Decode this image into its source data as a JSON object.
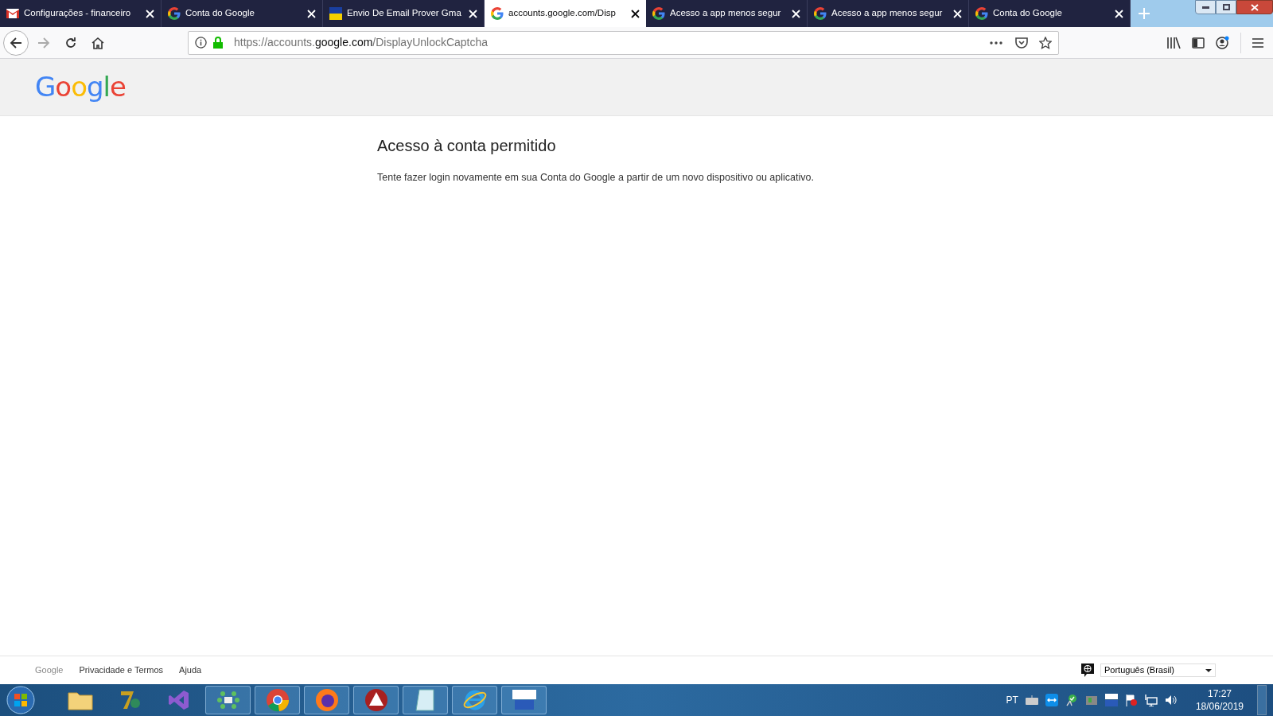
{
  "tabs": [
    {
      "title": "Configurações - financeiro",
      "kind": "mail",
      "selected": false
    },
    {
      "title": "Conta do Google",
      "kind": "google",
      "selected": false
    },
    {
      "title": "Envio De Email Prover Gma",
      "kind": "acbr",
      "selected": false
    },
    {
      "title": "accounts.google.com/Disp",
      "kind": "google",
      "selected": true
    },
    {
      "title": "Acesso a app menos segur",
      "kind": "google",
      "selected": false
    },
    {
      "title": "Acesso a app menos segur",
      "kind": "google",
      "selected": false
    },
    {
      "title": "Conta do Google",
      "kind": "google",
      "selected": false
    }
  ],
  "address_bar": {
    "url_prefix": "https://accounts.",
    "url_domain": "google.com",
    "url_path": "/DisplayUnlockCaptcha"
  },
  "header": {
    "logo": "Google"
  },
  "content": {
    "heading": "Acesso à conta permitido",
    "message": "Tente fazer login novamente em sua Conta do Google a partir de um novo dispositivo ou aplicativo."
  },
  "footer": {
    "brand": "Google",
    "links": [
      "Privacidade e Termos",
      "Ajuda"
    ],
    "language": "Português (Brasil)"
  },
  "taskbar": {
    "apps": [
      {
        "kind": "folder",
        "active": false
      },
      {
        "kind": "seven",
        "active": false
      },
      {
        "kind": "vs",
        "active": false
      },
      {
        "kind": "ib",
        "active": true
      },
      {
        "kind": "chrome",
        "active": true
      },
      {
        "kind": "firefox",
        "active": true
      },
      {
        "kind": "triangle",
        "active": true
      },
      {
        "kind": "notepad",
        "active": true
      },
      {
        "kind": "ie",
        "active": true
      },
      {
        "kind": "acbr",
        "active": true
      }
    ],
    "language": "PT",
    "time": "17:27",
    "date": "18/06/2019"
  }
}
